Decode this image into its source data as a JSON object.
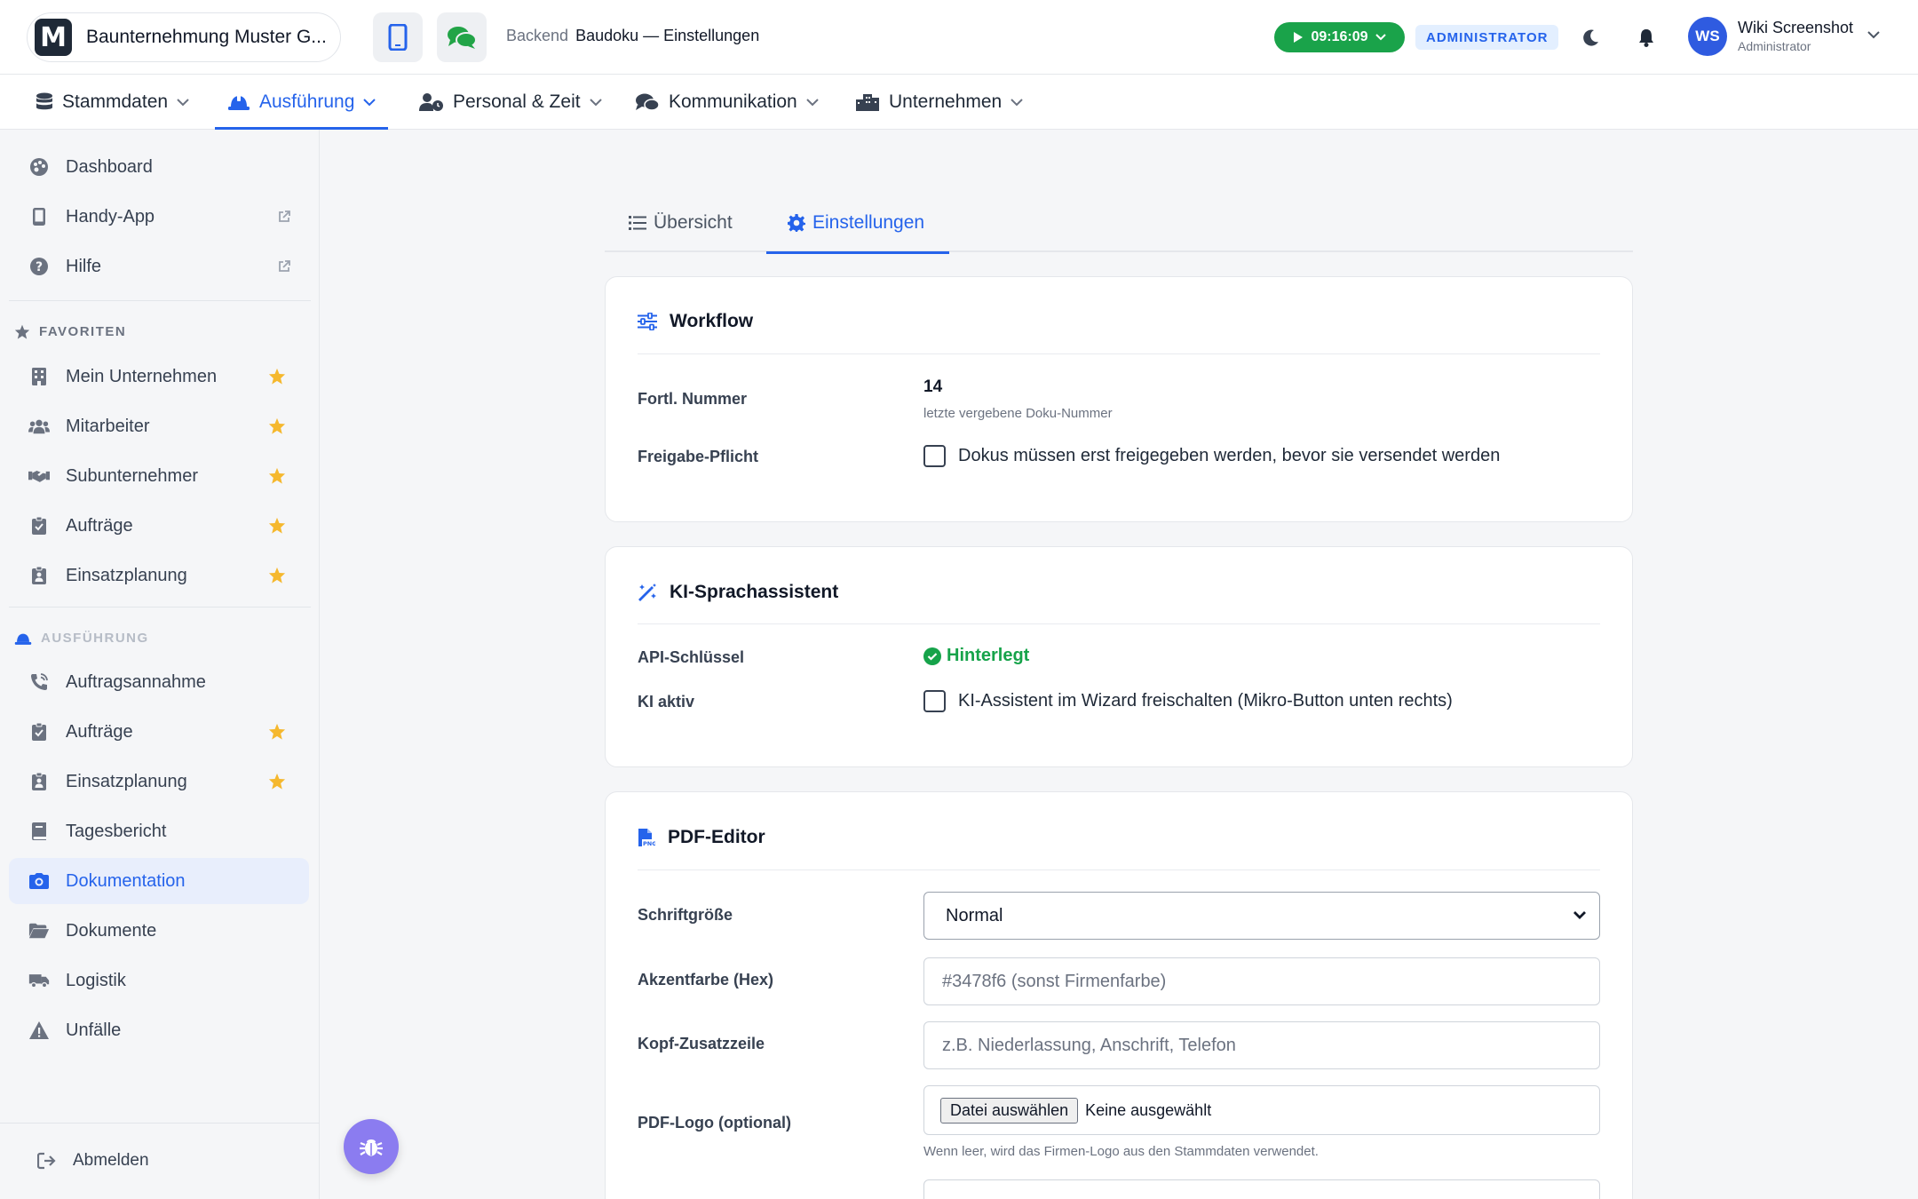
{
  "header": {
    "company_name": "Baunternehmung Muster G...",
    "logo_letter": "M",
    "breadcrumb_section": "Backend",
    "breadcrumb_page": "Baudoku — Einstellungen",
    "timer": "09:16:09",
    "role_badge": "ADMINISTRATOR",
    "user": {
      "initials": "WS",
      "name": "Wiki Screenshot",
      "role": "Administrator"
    }
  },
  "nav": {
    "items": [
      {
        "label": "Stammdaten",
        "icon": "database-icon"
      },
      {
        "label": "Ausführung",
        "icon": "hard-hat-icon",
        "active": true
      },
      {
        "label": "Personal & Zeit",
        "icon": "user-clock-icon"
      },
      {
        "label": "Kommunikation",
        "icon": "comments-icon"
      },
      {
        "label": "Unternehmen",
        "icon": "city-icon"
      }
    ]
  },
  "sidebar": {
    "top": [
      {
        "label": "Dashboard",
        "icon": "palette-icon"
      },
      {
        "label": "Handy-App",
        "icon": "mobile-icon",
        "external": true
      },
      {
        "label": "Hilfe",
        "icon": "question-circle-icon",
        "external": true
      }
    ],
    "favorites_heading": "FAVORITEN",
    "favorites": [
      {
        "label": "Mein Unternehmen",
        "icon": "building-icon"
      },
      {
        "label": "Mitarbeiter",
        "icon": "users-icon"
      },
      {
        "label": "Subunternehmer",
        "icon": "handshake-icon"
      },
      {
        "label": "Aufträge",
        "icon": "clipboard-check-icon"
      },
      {
        "label": "Einsatzplanung",
        "icon": "clipboard-user-icon"
      }
    ],
    "section_heading": "AUSFÜHRUNG",
    "section_items": [
      {
        "label": "Auftragsannahme",
        "icon": "phone-volume-icon",
        "star": false
      },
      {
        "label": "Aufträge",
        "icon": "clipboard-check-icon",
        "star": true
      },
      {
        "label": "Einsatzplanung",
        "icon": "clipboard-user-icon",
        "star": true
      },
      {
        "label": "Tagesbericht",
        "icon": "book-icon",
        "star": false
      },
      {
        "label": "Dokumentation",
        "icon": "camera-icon",
        "star": false,
        "active": true
      },
      {
        "label": "Dokumente",
        "icon": "folder-open-icon",
        "star": false
      },
      {
        "label": "Logistik",
        "icon": "truck-icon",
        "star": false
      },
      {
        "label": "Unfälle",
        "icon": "warning-icon",
        "star": false
      }
    ],
    "logout": "Abmelden"
  },
  "tabs": [
    {
      "label": "Übersicht",
      "icon": "list-icon"
    },
    {
      "label": "Einstellungen",
      "icon": "gear-icon",
      "active": true
    }
  ],
  "workflow": {
    "title": "Workflow",
    "running_number_label": "Fortl. Nummer",
    "running_number_value": "14",
    "running_number_hint": "letzte vergebene Doku-Nummer",
    "approval_label": "Freigabe-Pflicht",
    "approval_checkbox": "Dokus müssen erst freigegeben werden, bevor sie versendet werden"
  },
  "ai": {
    "title": "KI-Sprachassistent",
    "api_key_label": "API-Schlüssel",
    "api_key_status": "Hinterlegt",
    "ai_active_label": "KI aktiv",
    "ai_active_checkbox": "KI-Assistent im Wizard freischalten (Mikro-Button unten rechts)"
  },
  "pdf": {
    "title": "PDF-Editor",
    "font_size_label": "Schriftgröße",
    "font_size_value": "Normal",
    "accent_label": "Akzentfarbe (Hex)",
    "accent_placeholder": "#3478f6 (sonst Firmenfarbe)",
    "header_line_label": "Kopf-Zusatzzeile",
    "header_line_placeholder": "z.B. Niederlassung, Anschrift, Telefon",
    "logo_label": "PDF-Logo (optional)",
    "file_button": "Datei auswählen",
    "file_status": "Keine ausgewählt",
    "logo_hint": "Wenn leer, wird das Firmen-Logo aus den Stammdaten verwendet."
  },
  "colors": {
    "accent": "#2563eb",
    "success": "#16a34a",
    "star": "#f5b82e",
    "fab": "#8b7cf0"
  }
}
